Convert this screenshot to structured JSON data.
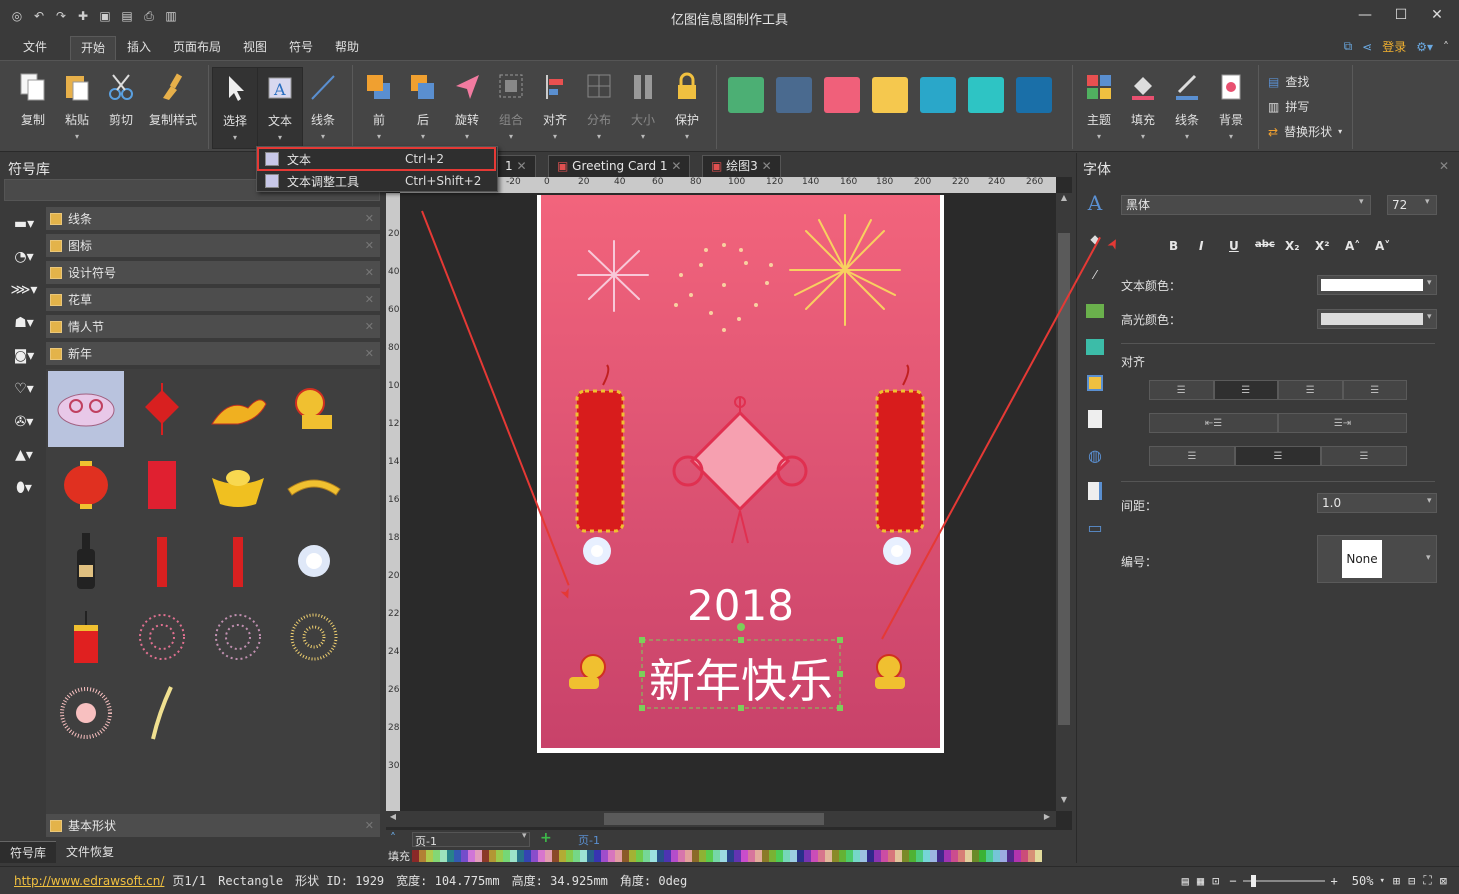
{
  "window": {
    "title": "亿图信息图制作工具"
  },
  "menu": {
    "tabs": [
      "文件",
      "开始",
      "插入",
      "页面布局",
      "视图",
      "符号",
      "帮助"
    ],
    "login": "登录"
  },
  "ribbon": {
    "buttons": [
      {
        "label": "复制",
        "icon": "copy-icon"
      },
      {
        "label": "粘贴",
        "icon": "paste-icon"
      },
      {
        "label": "剪切",
        "icon": "cut-icon"
      },
      {
        "label": "复制样式",
        "icon": "format-painter-icon"
      },
      {
        "label": "选择",
        "icon": "pointer-icon"
      },
      {
        "label": "文本",
        "icon": "text-tool-icon"
      },
      {
        "label": "线条",
        "icon": "line-icon"
      },
      {
        "label": "前",
        "icon": "bring-front-icon"
      },
      {
        "label": "后",
        "icon": "send-back-icon"
      },
      {
        "label": "旋转",
        "icon": "rotate-icon"
      },
      {
        "label": "组合",
        "icon": "group-icon"
      },
      {
        "label": "对齐",
        "icon": "align-icon"
      },
      {
        "label": "分布",
        "icon": "distribute-icon"
      },
      {
        "label": "大小",
        "icon": "size-icon"
      },
      {
        "label": "保护",
        "icon": "lock-icon"
      },
      {
        "label": "主题",
        "icon": "theme-icon"
      },
      {
        "label": "填充",
        "icon": "fill-bucket-icon"
      },
      {
        "label": "线条",
        "icon": "line-style-icon"
      },
      {
        "label": "背景",
        "icon": "background-icon"
      }
    ],
    "swatches": [
      "#4caf74",
      "#4a6a8f",
      "#f0607a",
      "#f5c84e",
      "#2aa7c9",
      "#2ec4c4",
      "#1a6fa8"
    ],
    "small": [
      "查找",
      "拼写",
      "替换形状"
    ]
  },
  "dropdown": {
    "items": [
      {
        "label": "文本",
        "shortcut": "Ctrl+2"
      },
      {
        "label": "文本调整工具",
        "shortcut": "Ctrl+Shift+2"
      }
    ]
  },
  "library": {
    "title": "符号库",
    "sections": [
      "线条",
      "图标",
      "设计符号",
      "花草",
      "情人节",
      "新年"
    ],
    "bottom_section": "基本形状",
    "tabs": [
      "符号库",
      "文件恢复"
    ]
  },
  "documents": {
    "tabs": [
      "1",
      "Greeting Card 1",
      "绘图3"
    ]
  },
  "ruler": {
    "h": [
      "-20",
      "0",
      "20",
      "40",
      "60",
      "80",
      "100",
      "120",
      "140",
      "160",
      "180",
      "200",
      "220",
      "240",
      "260"
    ],
    "v": [
      "20",
      "40",
      "60",
      "80",
      "100",
      "120",
      "140",
      "160",
      "180",
      "200",
      "220",
      "240",
      "260",
      "280",
      "300"
    ]
  },
  "card": {
    "year": "2018",
    "greeting": "新年快乐"
  },
  "pagebar": {
    "page": "页-1",
    "tab": "页-1",
    "fill_label": "填充"
  },
  "fontpanel": {
    "title": "字体",
    "font": "黑体",
    "size": "72",
    "format_buttons": [
      "B",
      "I",
      "U",
      "abc",
      "X₂",
      "X²",
      "A˄",
      "A˅"
    ],
    "text_color_label": "文本颜色：",
    "highlight_label": "高光颜色：",
    "align_label": "对齐",
    "spacing_label": "间距：",
    "spacing_value": "1.0",
    "numbering_label": "编号：",
    "numbering_value": "None"
  },
  "status": {
    "url": "http://www.edrawsoft.cn/",
    "page": "页1/1",
    "shape": "Rectangle",
    "shape_id": "形状 ID: 1929",
    "width": "宽度: 104.775mm",
    "height": "高度: 34.925mm",
    "angle": "角度: 0deg",
    "zoom": "50%"
  }
}
